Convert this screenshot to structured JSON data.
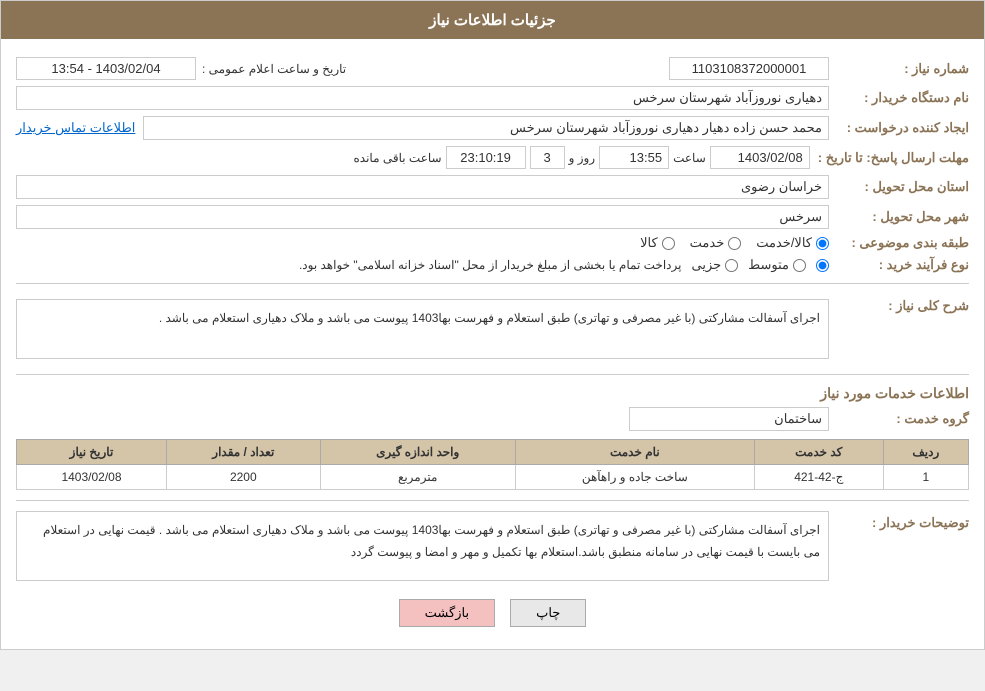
{
  "header": {
    "title": "جزئیات اطلاعات نیاز"
  },
  "fields": {
    "need_number_label": "شماره نیاز :",
    "need_number_value": "1103108372000001",
    "buyer_org_label": "نام دستگاه خریدار :",
    "buyer_org_value": "دهیاری نوروزآباد شهرستان سرخس",
    "creator_label": "ایجاد کننده درخواست :",
    "creator_value": "محمد حسن زاده دهیار دهیاری نوروزآباد شهرستان سرخس",
    "contact_link": "اطلاعات تماس خریدار",
    "deadline_label": "مهلت ارسال پاسخ: تا تاریخ :",
    "deadline_date": "1403/02/08",
    "deadline_time_label": "ساعت",
    "deadline_time": "13:55",
    "deadline_days_label": "روز و",
    "deadline_days": "3",
    "deadline_remain": "23:10:19",
    "deadline_remain_label": "ساعت باقی مانده",
    "province_label": "استان محل تحویل :",
    "province_value": "خراسان رضوی",
    "city_label": "شهر محل تحویل :",
    "city_value": "سرخس",
    "category_label": "طبقه بندی موضوعی :",
    "category_goods": "کالا",
    "category_service": "خدمت",
    "category_goods_service": "کالا/خدمت",
    "purchase_type_label": "نوع فرآیند خرید :",
    "purchase_type_1": "جزیی",
    "purchase_type_2": "متوسط",
    "purchase_type_3_checked": true,
    "purchase_type_text": "پرداخت تمام یا بخشی از مبلغ خریدار از محل \"اسناد خزانه اسلامی\" خواهد بود.",
    "announce_label": "تاریخ و ساعت اعلام عمومی :",
    "announce_value": "1403/02/04 - 13:54",
    "need_description_label": "شرح کلی نیاز :",
    "need_description": "اجرای آسفالت مشارکتی (با غیر مصرفی و تهاتری) طبق استعلام و فهرست بها1403 پیوست می باشد و ملاک دهیاری استعلام می باشد .",
    "service_info_title": "اطلاعات خدمات مورد نیاز",
    "service_group_label": "گروه خدمت :",
    "service_group_value": "ساختمان",
    "table_headers": {
      "row": "ردیف",
      "code": "کد خدمت",
      "name": "نام خدمت",
      "unit": "واحد اندازه گیری",
      "qty": "تعداد / مقدار",
      "date": "تاریخ نیاز"
    },
    "table_rows": [
      {
        "row": "1",
        "code": "ج-42-421",
        "name": "ساخت جاده و راهآهن",
        "unit": "مترمربع",
        "qty": "2200",
        "date": "1403/02/08"
      }
    ],
    "buyer_notes_label": "توضیحات خریدار :",
    "buyer_notes": "اجرای آسفالت مشارکتی (با غیر مصرفی و تهاتری) طبق استعلام و فهرست بها1403 پیوست می باشد و ملاک دهیاری استعلام می باشد . قیمت نهایی در استعلام می بایست با قیمت نهایی در سامانه منطبق باشد.استعلام بها تکمیل و مهر و امضا و پیوست گردد"
  },
  "buttons": {
    "print": "چاپ",
    "back": "بازگشت"
  }
}
